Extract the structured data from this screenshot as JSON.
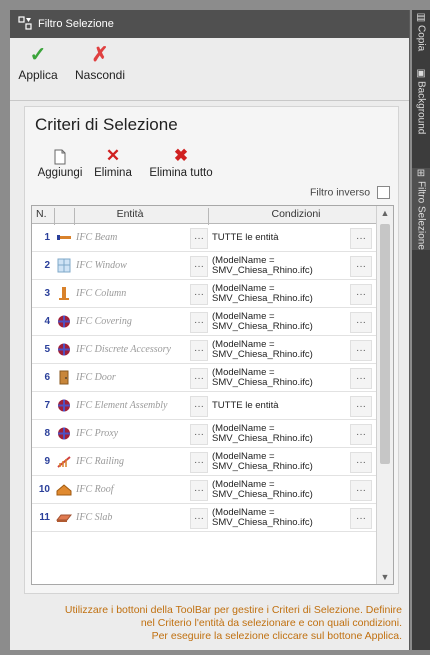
{
  "window": {
    "title": "Filtro Selezione"
  },
  "toolbar": {
    "apply_label": "Applica",
    "hide_label": "Nascondi"
  },
  "criteria": {
    "title": "Criteri di Selezione",
    "add_label": "Aggiungi",
    "delete_label": "Elimina",
    "delete_all_label": "Elimina tutto",
    "inverse_label": "Filtro inverso"
  },
  "table": {
    "headers": [
      "N.",
      "Entità",
      "Condizioni"
    ],
    "dots": "···",
    "rows": [
      {
        "n": "1",
        "entity": "IFC Beam",
        "icon": "beam-icon",
        "condition": "TUTTE le entità"
      },
      {
        "n": "2",
        "entity": "IFC Window",
        "icon": "window-icon",
        "condition": "(ModelName = SMV_Chiesa_Rhino.ifc)"
      },
      {
        "n": "3",
        "entity": "IFC Column",
        "icon": "column-icon",
        "condition": "(ModelName = SMV_Chiesa_Rhino.ifc)"
      },
      {
        "n": "4",
        "entity": "IFC Covering",
        "icon": "covering-icon",
        "condition": "(ModelName = SMV_Chiesa_Rhino.ifc)"
      },
      {
        "n": "5",
        "entity": "IFC Discrete Accessory",
        "icon": "discrete-accessory-icon",
        "condition": "(ModelName = SMV_Chiesa_Rhino.ifc)"
      },
      {
        "n": "6",
        "entity": "IFC Door",
        "icon": "door-icon",
        "condition": "(ModelName = SMV_Chiesa_Rhino.ifc)"
      },
      {
        "n": "7",
        "entity": "IFC Element Assembly",
        "icon": "element-assembly-icon",
        "condition": "TUTTE le entità"
      },
      {
        "n": "8",
        "entity": "IFC Proxy",
        "icon": "proxy-icon",
        "condition": "(ModelName = SMV_Chiesa_Rhino.ifc)"
      },
      {
        "n": "9",
        "entity": "IFC Railing",
        "icon": "railing-icon",
        "condition": "(ModelName = SMV_Chiesa_Rhino.ifc)"
      },
      {
        "n": "10",
        "entity": "IFC Roof",
        "icon": "roof-icon",
        "condition": "(ModelName = SMV_Chiesa_Rhino.ifc)"
      },
      {
        "n": "11",
        "entity": "IFC Slab",
        "icon": "slab-icon",
        "condition": "(ModelName = SMV_Chiesa_Rhino.ifc)"
      }
    ]
  },
  "info": {
    "line1": "Utilizzare i bottoni della ToolBar per gestire i Criteri di Selezione. Definire",
    "line2": "nel Criterio l'entità da selezionare e con quali condizioni.",
    "line3": "Per eseguire la selezione cliccare sul bottone Applica."
  },
  "side_tabs": [
    {
      "label": "Copia",
      "icon": "copy-icon"
    },
    {
      "label": "Background",
      "icon": "background-icon"
    },
    {
      "label": "Filtro Selezione",
      "icon": "filter-icon",
      "active": true
    }
  ]
}
